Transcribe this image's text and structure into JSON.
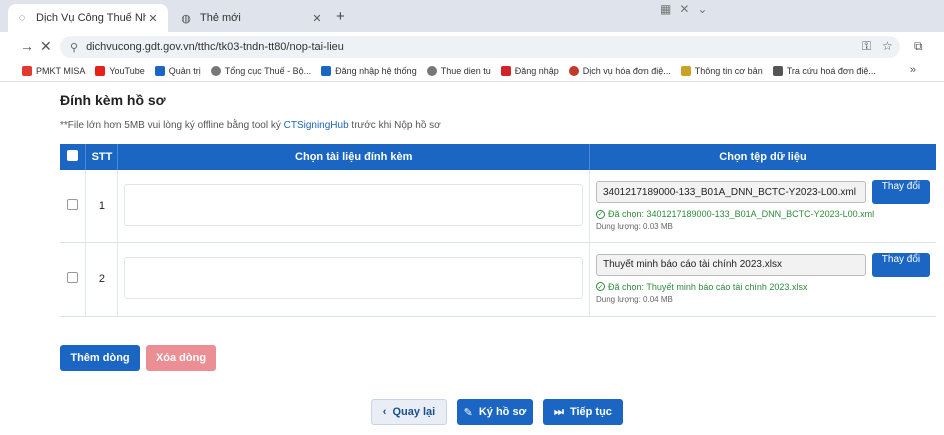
{
  "browser": {
    "tabs": [
      {
        "label": "Dịch Vụ Công Thuế Nhà Nước",
        "icon": "loading-icon"
      },
      {
        "label": "Thẻ mới",
        "icon": "globe-icon"
      }
    ],
    "url": "dichvucong.gdt.gov.vn/tthc/tk03-tndn-tt80/nop-tai-lieu",
    "bookmarks": [
      {
        "label": "PMKT MISA",
        "color": "#e23a2e"
      },
      {
        "label": "YouTube",
        "color": "#e62117"
      },
      {
        "label": "Quản trị",
        "color": "#1a66c2"
      },
      {
        "label": "Tổng cục Thuế - Bộ...",
        "color": "#777777"
      },
      {
        "label": "Đăng nhập hệ thống",
        "color": "#1a66c2"
      },
      {
        "label": "Thue dien tu",
        "color": "#777777"
      },
      {
        "label": "Đăng nhập",
        "color": "#d2232a"
      },
      {
        "label": "Dịch vụ hóa đơn điệ...",
        "color": "#c0392b"
      },
      {
        "label": "Thông tin cơ bản",
        "color": "#c9a227"
      },
      {
        "label": "Tra cứu hoá đơn điệ...",
        "color": "#555555"
      }
    ]
  },
  "page": {
    "title": "Đính kèm hồ sơ",
    "note_prefix": "**File lớn hơn 5MB vui lòng ký offline bằng tool ký ",
    "note_link": "CTSigningHub",
    "note_suffix": " trước khi Nộp hồ sơ",
    "table": {
      "headers": {
        "stt": "STT",
        "attach": "Chọn tài liệu đính kèm",
        "file": "Chọn tệp dữ liệu"
      },
      "rows": [
        {
          "stt": "1",
          "file_name": "3401217189000-133_B01A_DNN_BCTC-Y2023-L00.xml",
          "change_label": "Thay đổi",
          "chosen": "Đã chọn: 3401217189000-133_B01A_DNN_BCTC-Y2023-L00.xml",
          "size": "Dung lượng: 0.03 MB"
        },
        {
          "stt": "2",
          "file_name": "Thuyết minh báo cáo tài chính 2023.xlsx",
          "change_label": "Thay đổi",
          "chosen": "Đã chọn: Thuyết minh báo cáo tài chính 2023.xlsx",
          "size": "Dung lượng: 0.04 MB"
        }
      ]
    },
    "buttons": {
      "add_row": "Thêm dòng",
      "delete_row": "Xóa dòng",
      "back": "Quay lại",
      "sign": "Ký hồ sơ",
      "next": "Tiếp tục"
    }
  },
  "colors": {
    "primary": "#1a66c2",
    "danger_disabled": "#ec8f94",
    "success": "#2e8b3a"
  }
}
